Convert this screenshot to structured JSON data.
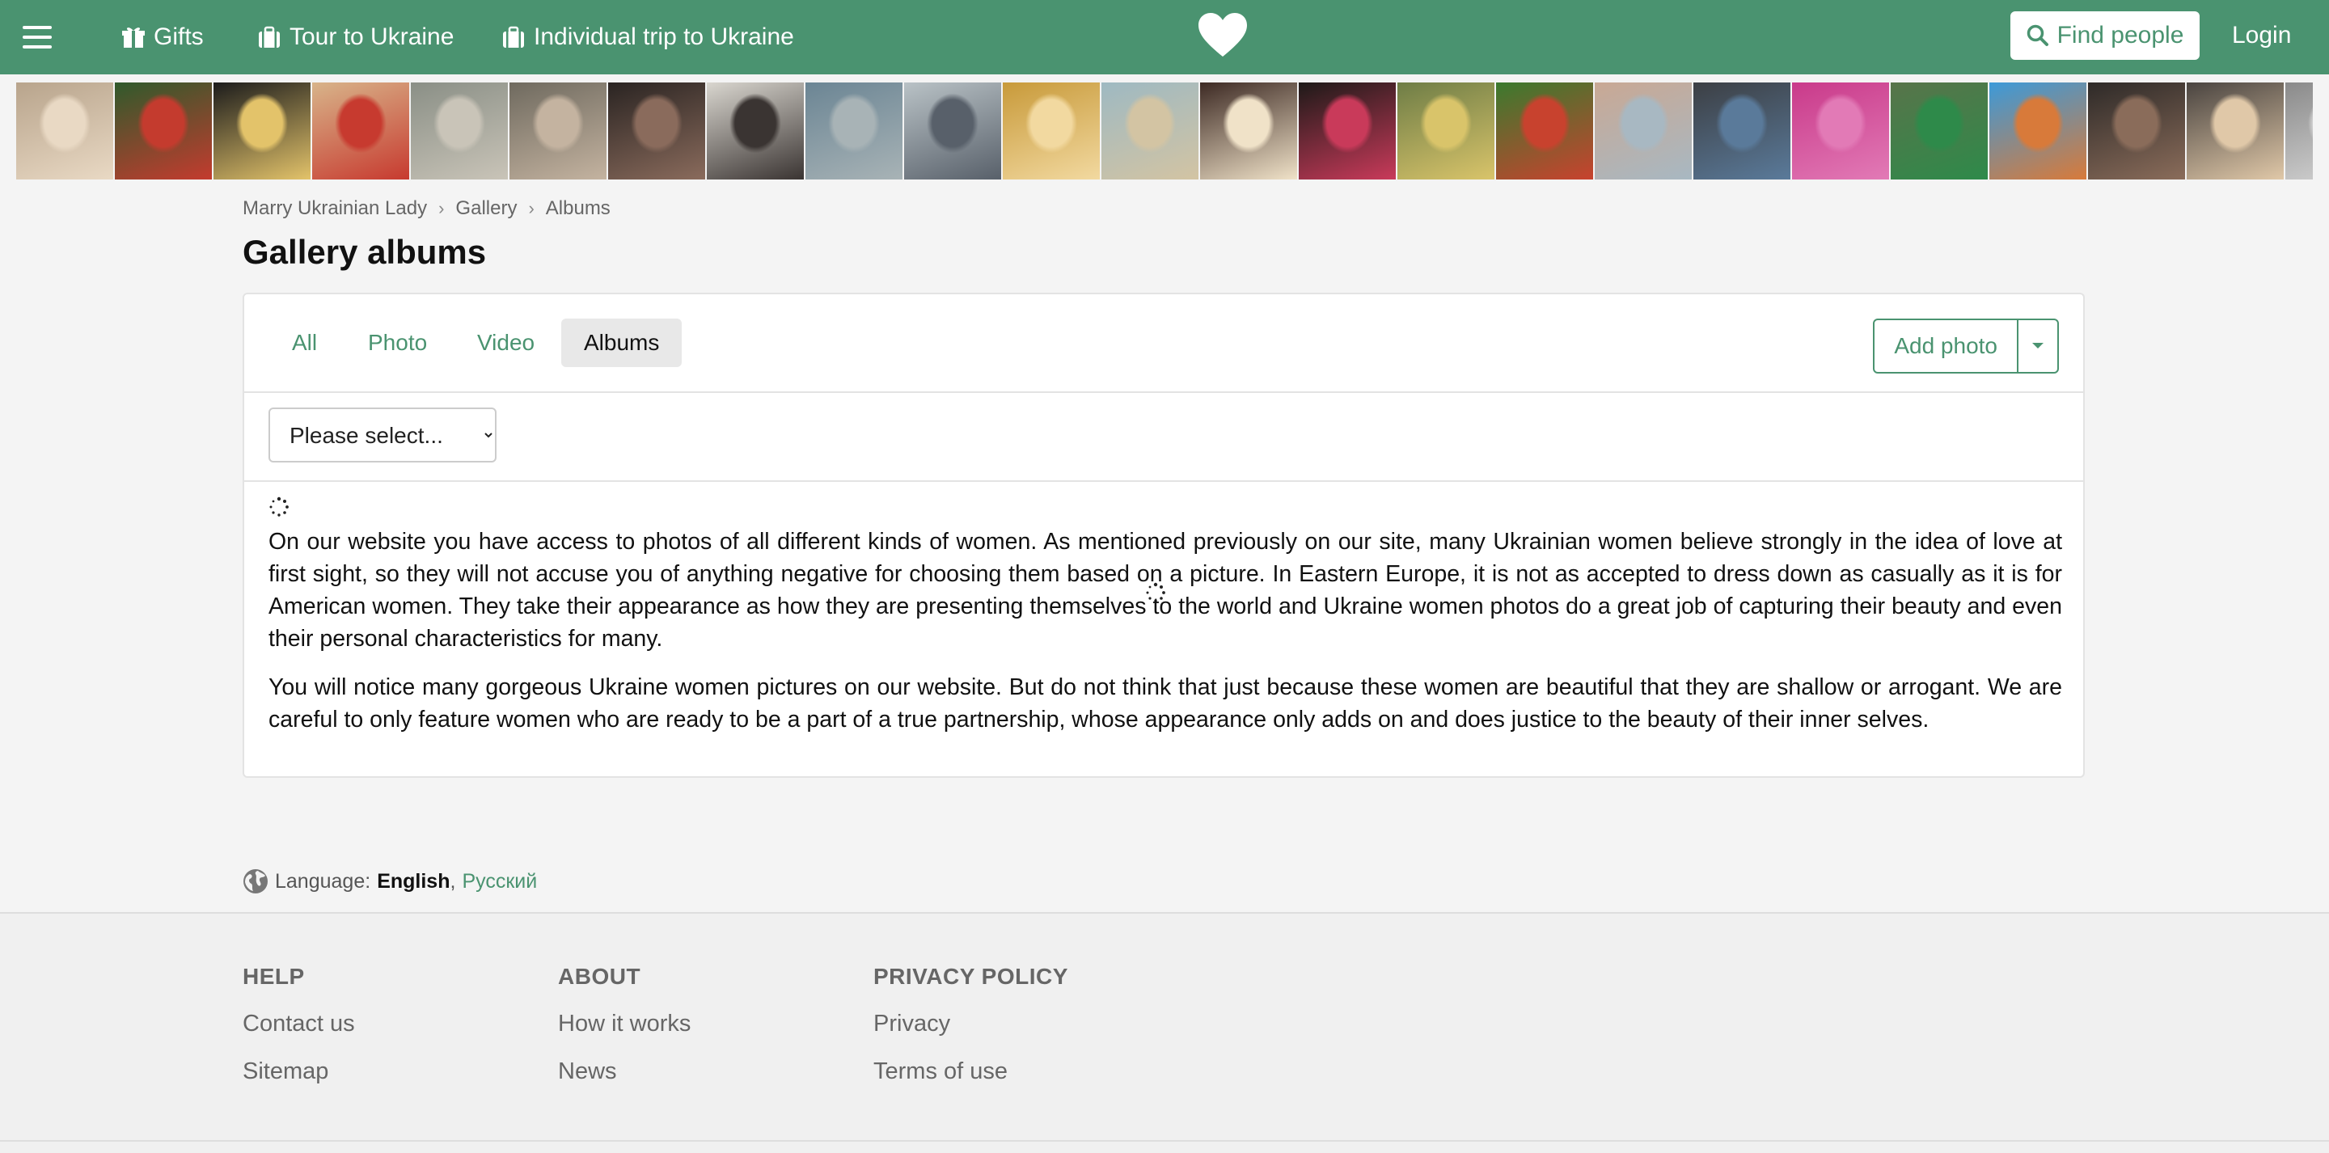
{
  "header": {
    "nav": [
      {
        "label": "Gifts",
        "icon": "gift-icon"
      },
      {
        "label": "Tour to Ukraine",
        "icon": "suitcase-icon"
      },
      {
        "label": "Individual trip to Ukraine",
        "icon": "suitcase-icon"
      }
    ],
    "logo_icon": "heart-icon",
    "find_people": "Find people",
    "login": "Login"
  },
  "photo_strip": {
    "count": 24
  },
  "breadcrumb": [
    "Marry Ukrainian Lady",
    "Gallery",
    "Albums"
  ],
  "page_title": "Gallery albums",
  "tabs": [
    {
      "label": "All",
      "active": false
    },
    {
      "label": "Photo",
      "active": false
    },
    {
      "label": "Video",
      "active": false
    },
    {
      "label": "Albums",
      "active": true
    }
  ],
  "add_photo": "Add photo",
  "album_select": {
    "selected": "Please select..."
  },
  "content": {
    "paragraph1": "On our website you have access to photos of all different kinds of women. As mentioned previously on our site, many Ukrainian women believe strongly in the idea of love at first sight, so they will not accuse you of anything negative for choosing them based on a picture. In Eastern Europe, it is not as accepted to dress down as casually as it is for American women. They take their appearance as how they are presenting themselves to the world and Ukraine women photos do a great job of capturing their beauty and even their personal characteristics for many.",
    "paragraph2": "You will notice many gorgeous Ukraine women pictures on our website. But do not think that just because these women are beautiful that they are shallow or arrogant. We are careful to only feature women who are ready to be a part of a true partnership, whose appearance only adds on and does justice to the beauty of their inner selves."
  },
  "language": {
    "label": "Language:",
    "current": "English",
    "separator": ",",
    "alternate": "Русский"
  },
  "footer": {
    "columns": [
      {
        "title": "HELP",
        "links": [
          "Contact us",
          "Sitemap"
        ]
      },
      {
        "title": "ABOUT",
        "links": [
          "How it works",
          "News"
        ]
      },
      {
        "title": "PRIVACY POLICY",
        "links": [
          "Privacy",
          "Terms of use"
        ]
      }
    ]
  },
  "colors": {
    "brand": "#4a9370"
  }
}
